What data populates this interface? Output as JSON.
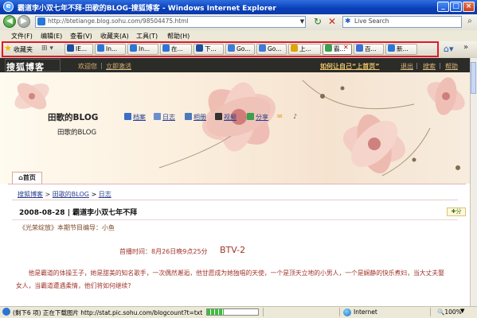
{
  "window": {
    "title": "霸道李小双七年不拜-田歌的BLOG-搜狐博客 - Windows Internet Explorer",
    "icon": "ie-icon"
  },
  "address": {
    "url": "http://btetiange.blog.sohu.com/98504475.html",
    "search_placeholder": "Live Search"
  },
  "menu": [
    "文件(F)",
    "编辑(E)",
    "查看(V)",
    "收藏夹(A)",
    "工具(T)",
    "帮助(H)"
  ],
  "favorites_label": "收藏夹",
  "tabs": [
    {
      "label": "IE...",
      "color": "#1a4fa0"
    },
    {
      "label": "In...",
      "color": "#2a76d6"
    },
    {
      "label": "In...",
      "color": "#2a76d6"
    },
    {
      "label": "在...",
      "color": "#2a76d6"
    },
    {
      "label": "下...",
      "color": "#1a4fa0"
    },
    {
      "label": "Go...",
      "color": "#3b7dd8"
    },
    {
      "label": "Go...",
      "color": "#3b7dd8"
    },
    {
      "label": "上...",
      "color": "#e0a400"
    },
    {
      "label": "霸...",
      "color": "#3aa050",
      "active": true
    },
    {
      "label": "百...",
      "color": "#3a6fd8"
    },
    {
      "label": "新...",
      "color": "#2a76d6"
    }
  ],
  "sohu": {
    "logo": "搜狐博客",
    "welcome": "欢迎您",
    "register": "立即激活",
    "set_home": "如何让自己“上首页”",
    "exit": "退出",
    "search": "搜索",
    "help": "帮助"
  },
  "blog": {
    "title": "田歌的BLOG",
    "subtitle": "田歌的BLOG",
    "nav": [
      "档案",
      "日志",
      "相册",
      "视频",
      "分享"
    ],
    "home_tab": "首页"
  },
  "breadcrumb": {
    "items": [
      "搜狐博客",
      "田歌的BLOG",
      "日志"
    ],
    "separator": ">"
  },
  "post": {
    "title": "2008-08-28 | 霸道李小双七年不拜",
    "share": "分",
    "program": "《光荣绽放》本期节目编导：小鱼",
    "airtime": "首播时间：8月26日晚9点25分",
    "channel": "BTV-2",
    "para_line1": "他是霸道的体操王子，她是甜美的知名歌手，一次偶然邂逅，他甘愿成为她独唱的天使，一个是顶天立地的小男人，一个是娴静的快乐煮妇，当大丈夫娶",
    "para_line2": "女人，当霸道遭遇柔情，他们将如何继续?"
  },
  "status": {
    "text": "(剩下6 项) 正在下载图片 http://stat.pic.sohu.com/blogcount?t=txt",
    "progress": 0.33,
    "zone": "Internet",
    "zoom": "100%"
  }
}
